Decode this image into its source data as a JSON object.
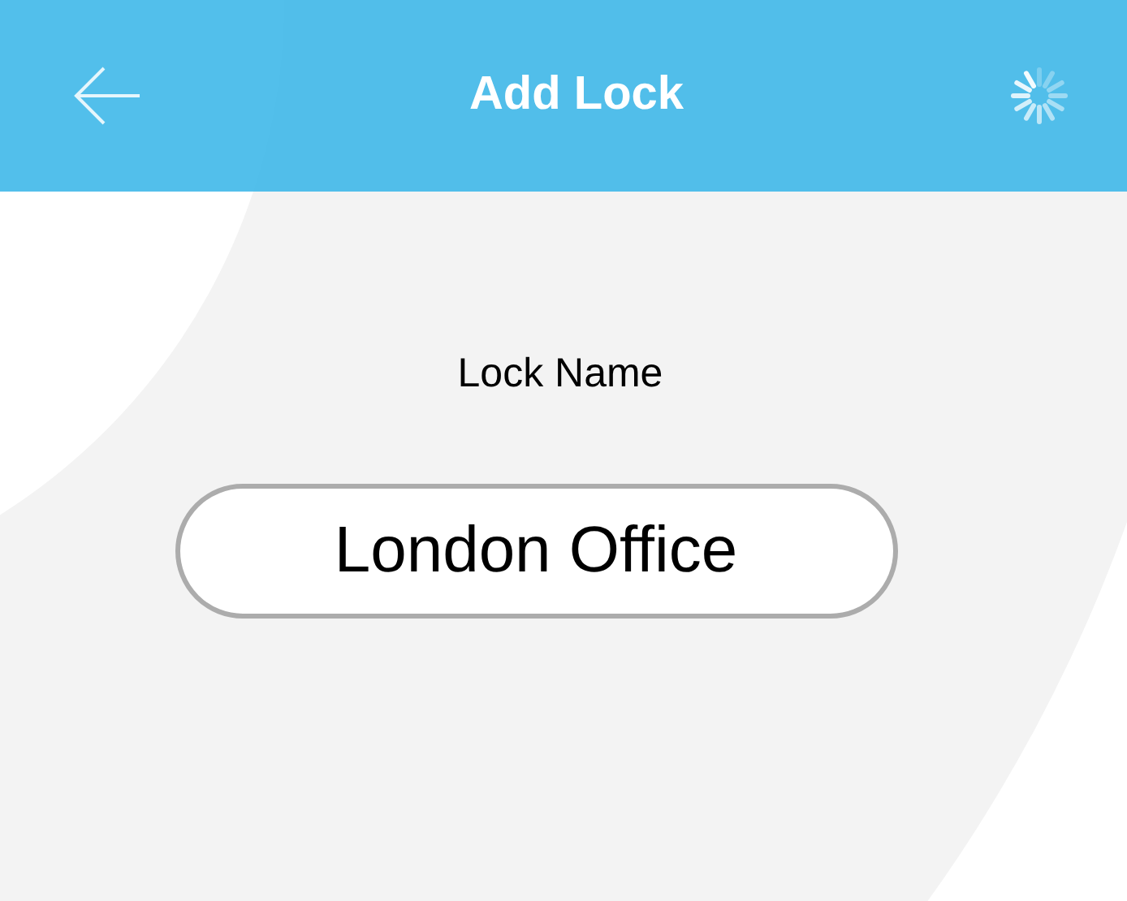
{
  "header": {
    "title": "Add Lock"
  },
  "form": {
    "label": "Lock Name",
    "value": "London Office"
  }
}
